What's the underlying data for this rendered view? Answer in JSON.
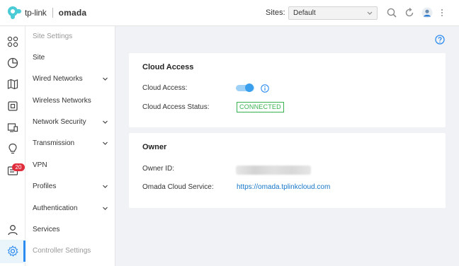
{
  "header": {
    "brand_tplink": "tp-link",
    "brand_omada": "omada",
    "sites_label": "Sites:",
    "sites_value": "Default",
    "icons": [
      "search-icon",
      "refresh-icon",
      "user-avatar-icon",
      "more-vertical-icon"
    ]
  },
  "rail": {
    "icons": [
      "dashboard-icon",
      "statistics-icon",
      "map-icon",
      "devices-icon",
      "insight-icon",
      "logs-icon",
      "notifications-icon",
      "account-icon",
      "settings-icon"
    ],
    "badge_count": "20"
  },
  "menu": {
    "title": "Site Settings",
    "items": [
      {
        "label": "Site"
      },
      {
        "label": "Wired Networks"
      },
      {
        "label": "Wireless Networks"
      },
      {
        "label": "Network Security"
      },
      {
        "label": "Transmission"
      },
      {
        "label": "VPN"
      },
      {
        "label": "Profiles"
      },
      {
        "label": "Authentication"
      },
      {
        "label": "Services"
      },
      {
        "label": "Controller Settings"
      }
    ]
  },
  "cloud_access": {
    "title": "Cloud Access",
    "access_label": "Cloud Access:",
    "access_enabled": true,
    "status_label": "Cloud Access Status:",
    "status_value": "CONNECTED"
  },
  "owner": {
    "title": "Owner",
    "owner_id_label": "Owner ID:",
    "cloud_service_label": "Omada Cloud Service:",
    "cloud_service_link": "https://omada.tplinkcloud.com"
  },
  "colors": {
    "accent": "#2d8cf0",
    "connected": "#38b24f",
    "badge": "#e02d3c",
    "link": "#1677c9"
  }
}
